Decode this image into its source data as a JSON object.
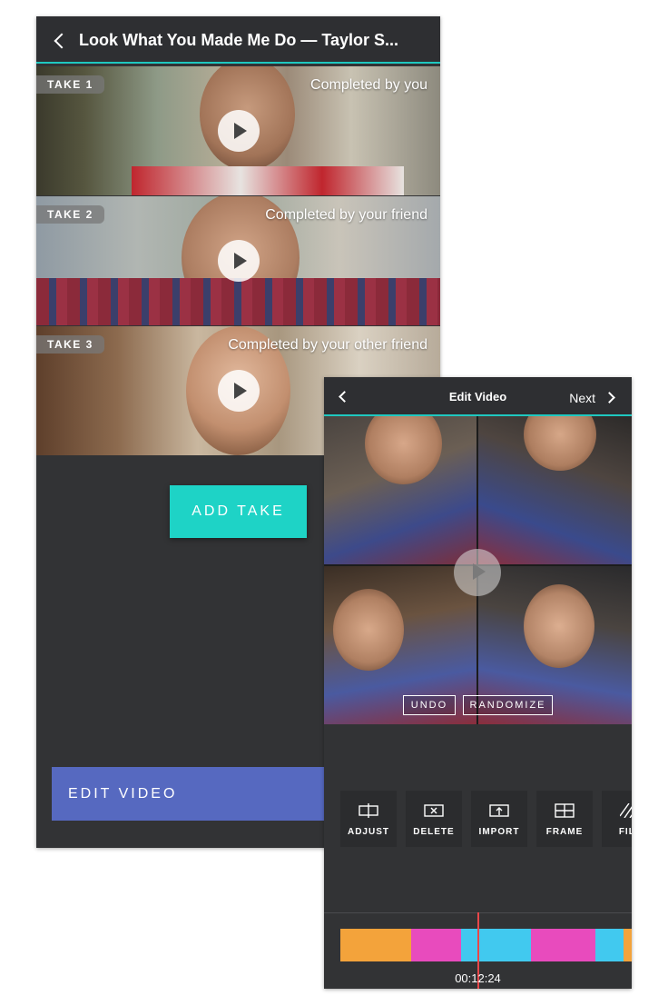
{
  "screen1": {
    "title": "Look What You Made Me Do — Taylor S...",
    "takes": [
      {
        "label": "TAKE 1",
        "status": "Completed by you"
      },
      {
        "label": "TAKE 2",
        "status": "Completed by your friend"
      },
      {
        "label": "TAKE 3",
        "status": "Completed by your other friend"
      }
    ],
    "add_take_label": "ADD TAKE",
    "edit_video_label": "EDIT VIDEO"
  },
  "screen2": {
    "title": "Edit Video",
    "next_label": "Next",
    "undo_label": "UNDO",
    "randomize_label": "RANDOMIZE",
    "tools": [
      {
        "label": "ADJUST",
        "icon": "adjust-icon"
      },
      {
        "label": "DELETE",
        "icon": "delete-icon"
      },
      {
        "label": "IMPORT",
        "icon": "import-icon"
      },
      {
        "label": "FRAME",
        "icon": "frame-icon"
      },
      {
        "label": "FILT",
        "icon": "filter-icon"
      }
    ],
    "timeline_colors": [
      "#f3a33b",
      "#e84bbd",
      "#41c9ef",
      "#e84bbd",
      "#41c9ef",
      "#f3a33b"
    ],
    "timecode": "00:12:24"
  },
  "colors": {
    "accent_teal": "#1ed3c6",
    "edit_blue": "#5669c0",
    "background_dark": "#323335",
    "playhead_red": "#e8474a"
  }
}
